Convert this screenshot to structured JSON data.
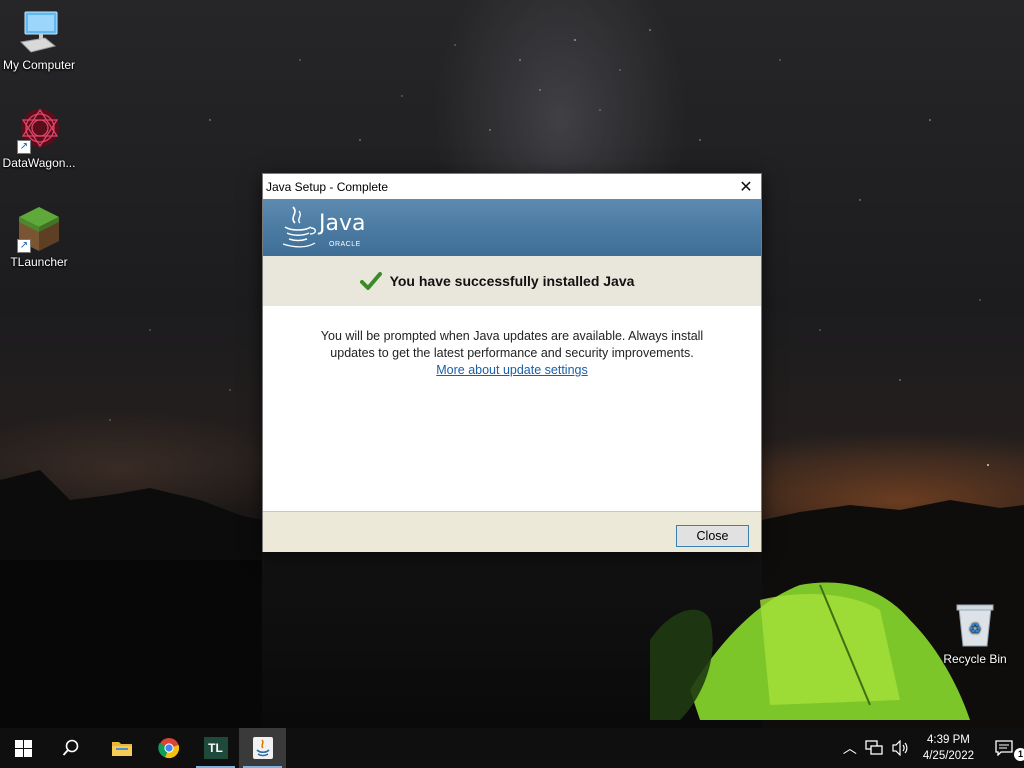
{
  "desktop": {
    "icons": [
      {
        "label": "My Computer",
        "icon": "computer-icon"
      },
      {
        "label": "DataWagon...",
        "icon": "datawagon-icon"
      },
      {
        "label": "TLauncher",
        "icon": "grass-block-icon"
      },
      {
        "label": "Recycle Bin",
        "icon": "recycle-bin-icon"
      }
    ]
  },
  "dialog": {
    "title": "Java Setup - Complete",
    "logo_text": "Java",
    "logo_sub": "ORACLE",
    "success_message": "You have successfully installed Java",
    "body_text": "You will be prompted when Java updates are available. Always install updates to get the latest performance and security improvements.",
    "link_text": "More about update settings",
    "close_button": "Close",
    "colors": {
      "banner": "#4a7aa2",
      "check": "#3a8a2a",
      "link": "#1a5ea8"
    }
  },
  "taskbar": {
    "apps": [
      {
        "name": "start",
        "icon": "windows-start-icon"
      },
      {
        "name": "search",
        "icon": "search-icon"
      },
      {
        "name": "file-explorer",
        "icon": "folder-icon"
      },
      {
        "name": "chrome",
        "icon": "chrome-icon"
      },
      {
        "name": "tlauncher",
        "icon": "tlauncher-icon",
        "label": "TL"
      },
      {
        "name": "java-setup",
        "icon": "java-icon"
      }
    ],
    "clock": {
      "time": "4:39 PM",
      "date": "4/25/2022"
    },
    "notification_count": "1"
  }
}
